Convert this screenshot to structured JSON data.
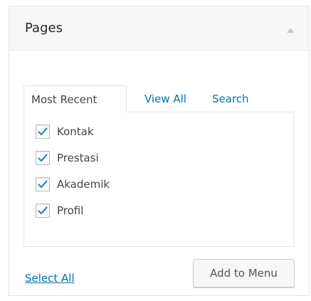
{
  "panel": {
    "title": "Pages",
    "toggle_icon": "triangle-up-icon"
  },
  "tabs": [
    {
      "label": "Most Recent",
      "active": true
    },
    {
      "label": "View All",
      "active": false
    },
    {
      "label": "Search",
      "active": false
    }
  ],
  "items": [
    {
      "label": "Kontak",
      "checked": true
    },
    {
      "label": "Prestasi",
      "checked": true
    },
    {
      "label": "Akademik",
      "checked": true
    },
    {
      "label": "Profil",
      "checked": true
    }
  ],
  "footer": {
    "select_all_label": "Select All",
    "add_button_label": "Add to Menu"
  },
  "colors": {
    "link": "#0073aa",
    "check": "#1e8cbe",
    "border": "#e5e5e5",
    "header_bg": "#f7f7f7"
  }
}
